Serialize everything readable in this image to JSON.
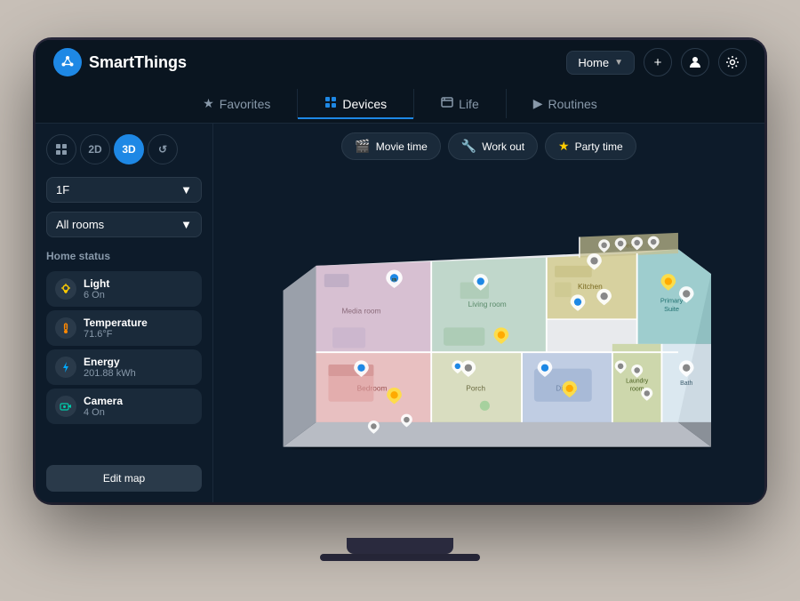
{
  "app": {
    "name": "SmartThings",
    "logo_symbol": "❋"
  },
  "header": {
    "home_label": "Home",
    "add_label": "+",
    "profile_icon": "👤",
    "settings_icon": "⚙"
  },
  "nav": {
    "tabs": [
      {
        "id": "favorites",
        "label": "Favorites",
        "icon": "★",
        "active": false
      },
      {
        "id": "devices",
        "label": "Devices",
        "icon": "⊞",
        "active": true
      },
      {
        "id": "life",
        "label": "Life",
        "icon": "☰",
        "active": false
      },
      {
        "id": "routines",
        "label": "Routines",
        "icon": "▶",
        "active": false
      }
    ]
  },
  "sidebar": {
    "view_buttons": [
      {
        "id": "grid",
        "label": "⊞",
        "active": false
      },
      {
        "id": "2d",
        "label": "2D",
        "active": false
      },
      {
        "id": "3d",
        "label": "3D",
        "active": true
      },
      {
        "id": "history",
        "label": "↺",
        "active": false
      }
    ],
    "floor": "1F",
    "room": "All rooms",
    "home_status_label": "Home status",
    "status_items": [
      {
        "id": "light",
        "name": "Light",
        "value": "6 On",
        "icon": "💡",
        "type": "light"
      },
      {
        "id": "temperature",
        "name": "Temperature",
        "value": "71.6°F",
        "icon": "🌡",
        "type": "temp"
      },
      {
        "id": "energy",
        "name": "Energy",
        "value": "201.88 kWh",
        "icon": "⚡",
        "type": "energy"
      },
      {
        "id": "camera",
        "name": "Camera",
        "value": "4 On",
        "icon": "📷",
        "type": "camera"
      }
    ],
    "edit_map_label": "Edit map"
  },
  "scenes": [
    {
      "id": "movie",
      "label": "Movie time",
      "icon": "🎬"
    },
    {
      "id": "workout",
      "label": "Work out",
      "icon": "🔧"
    },
    {
      "id": "party",
      "label": "Party time",
      "icon": "⭐"
    }
  ],
  "colors": {
    "accent": "#1e88e5",
    "active_tab_underline": "#1e88e5",
    "bg_dark": "#0d1b2a",
    "bg_darker": "#0a1520",
    "sidebar_item": "#1a2a3a"
  }
}
